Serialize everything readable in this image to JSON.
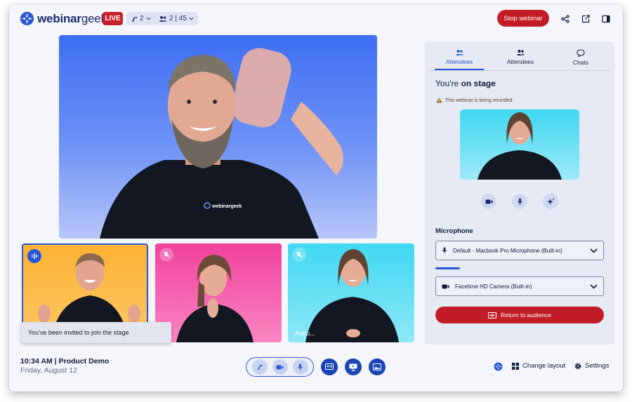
{
  "app": {
    "logo_text_bold": "webinar",
    "logo_text_light": "geek",
    "live_label": "LIVE",
    "presenters_count": "2",
    "attendees_counts": "2 | 45",
    "stop_label": "Stop webinar"
  },
  "thumbnails": [
    {
      "name": ""
    },
    {
      "name": ""
    },
    {
      "name": "Anou..."
    }
  ],
  "toast": "You've been invited to join the stage",
  "footer": {
    "time_title": "10:34 AM | Product Demo",
    "date": "Friday, August 12",
    "change_layout_label": "Change layout",
    "settings_label": "Settings"
  },
  "panel": {
    "tabs": [
      {
        "label": "Attendees",
        "icon": "users-icon",
        "active": true
      },
      {
        "label": "Attendees",
        "icon": "users-icon",
        "active": false
      },
      {
        "label": "Chats",
        "icon": "chat-icon",
        "active": false
      }
    ],
    "stage_prefix": "You're ",
    "stage_bold": "on stage",
    "recording_warning": "This webinar is being recorded.",
    "microphone_label": "Microphone",
    "microphone_value": "Default - Macbook Pro Microphone (Built-in)",
    "camera_value": "Facetime HD Camera (Built-in)",
    "return_label": "Return to audience"
  },
  "colors": {
    "accent": "#2b57d6",
    "live_red": "#c8202a",
    "stop_red": "#c21c26",
    "navy": "#101a3d"
  }
}
